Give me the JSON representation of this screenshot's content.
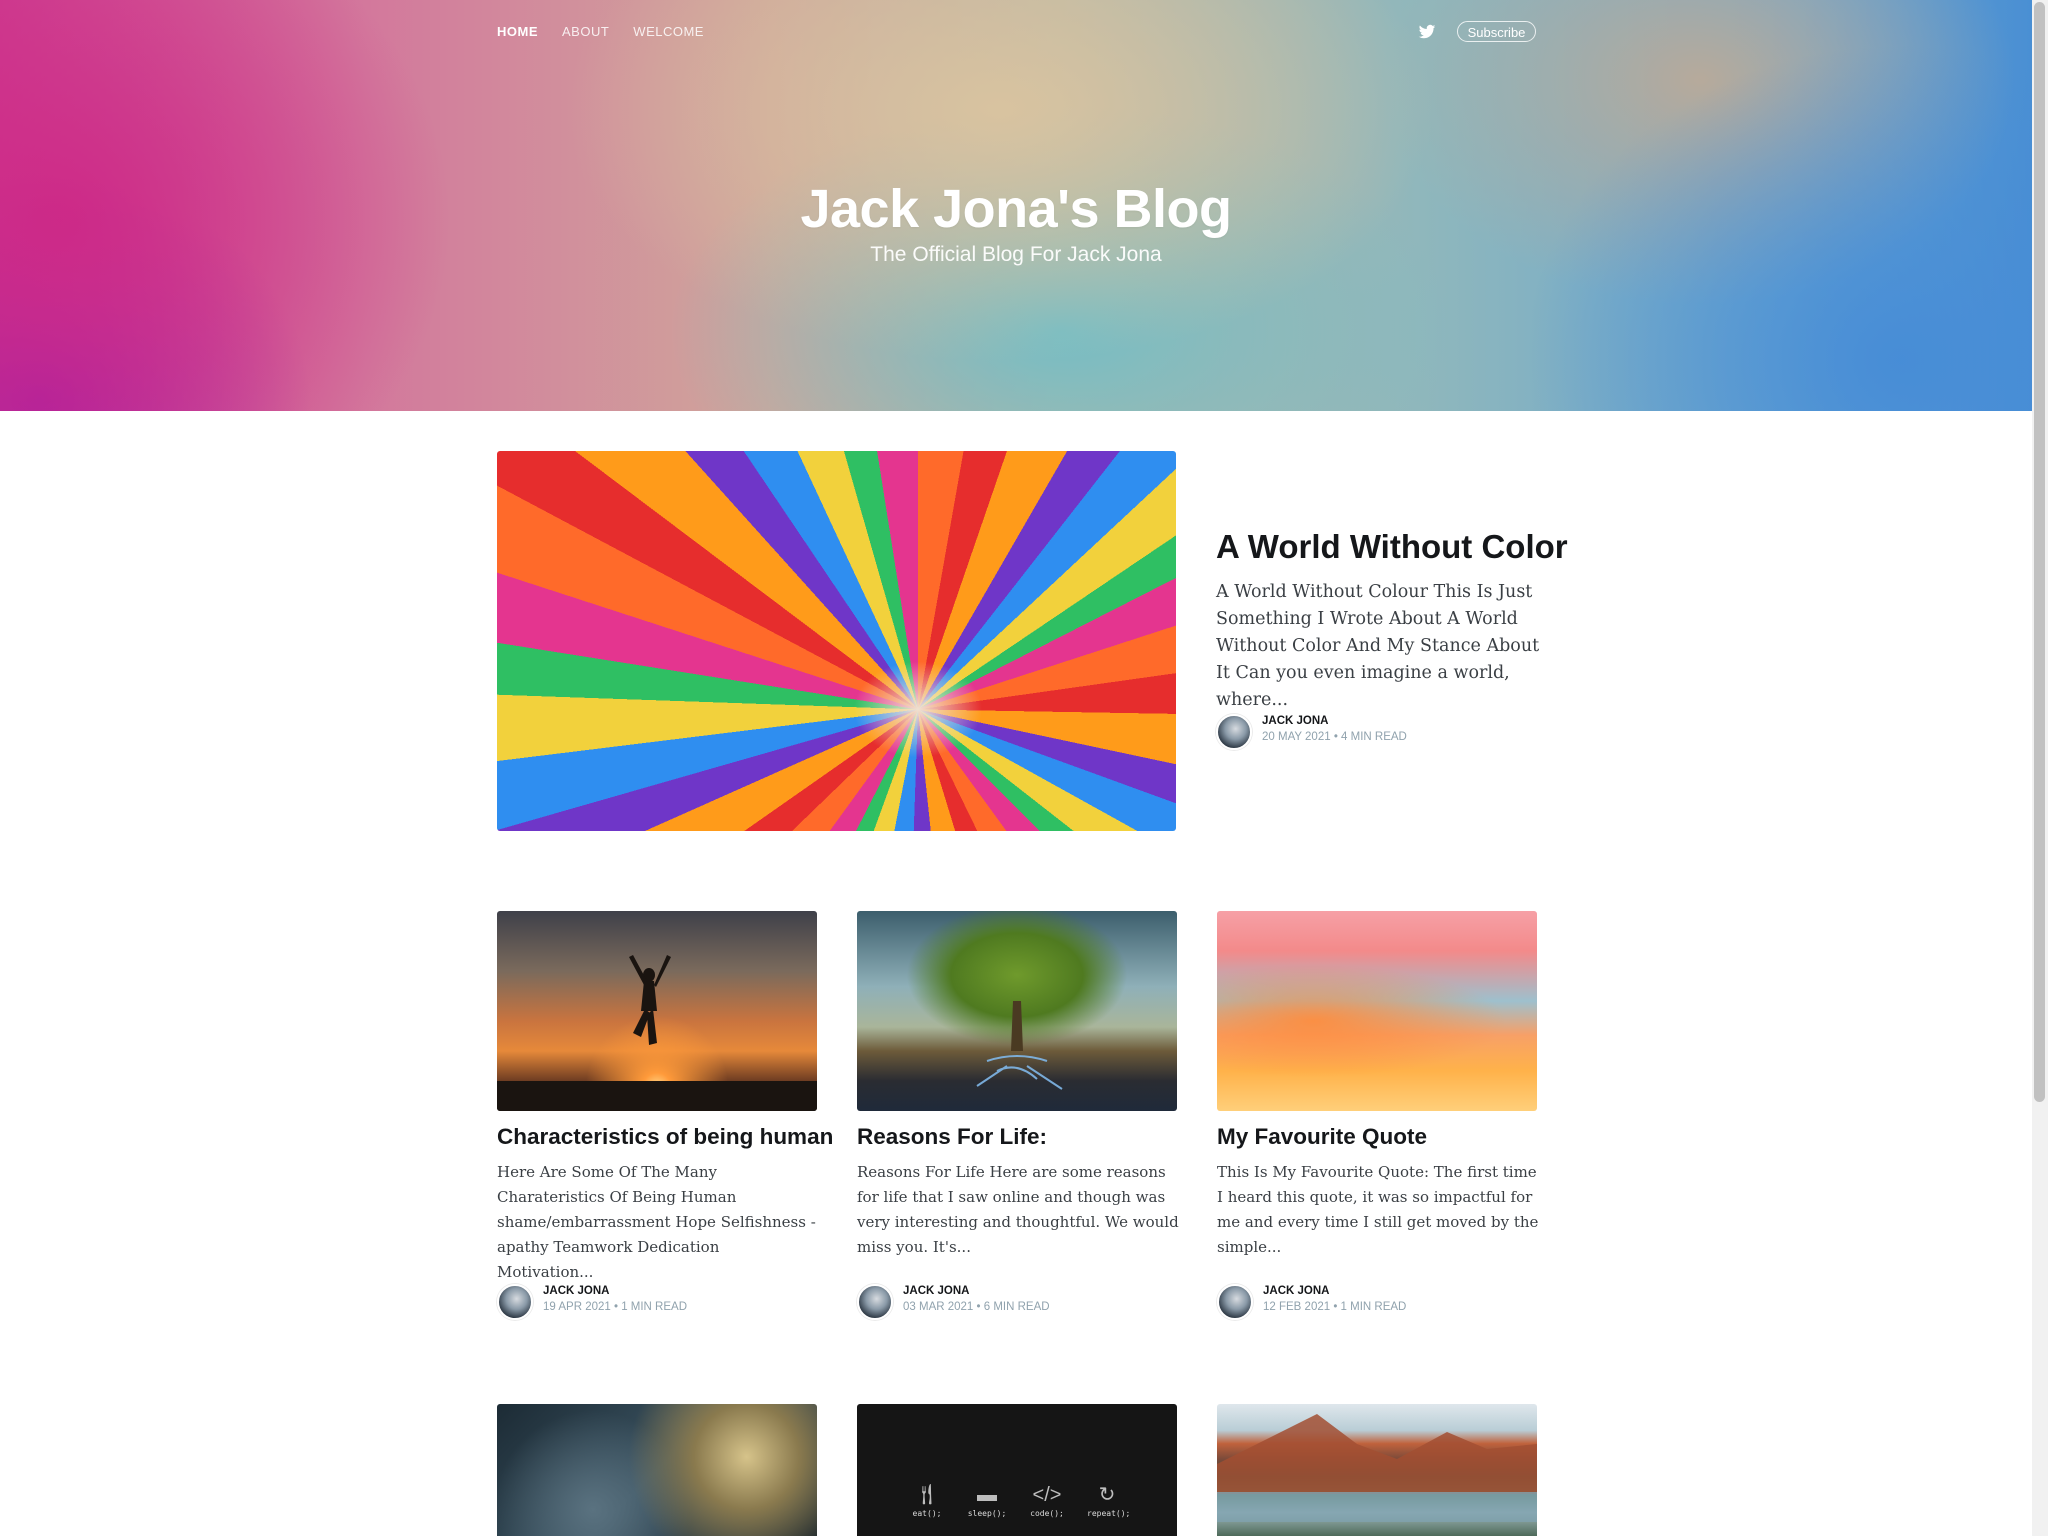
{
  "nav": {
    "items": [
      "HOME",
      "ABOUT",
      "WELCOME"
    ],
    "subscribe_label": "Subscribe",
    "twitter_icon": "twitter-icon"
  },
  "site": {
    "title": "Jack Jona's Blog",
    "description": "The Official Blog For Jack Jona"
  },
  "featured": {
    "title": "A World Without Color",
    "excerpt": "A World Without Colour This Is Just Something I Wrote About A World Without Color And My Stance About It Can you even imagine a world, where...",
    "author": "JACK JONA",
    "meta": "20 MAY 2021 • 4 MIN READ"
  },
  "posts": [
    {
      "title": "Characteristics of being human",
      "excerpt": "Here Are Some Of The Many Charateristics Of Being Human shame/embarrassment Hope Selfishness -apathy Teamwork Dedication Motivation...",
      "author": "JACK JONA",
      "meta": "19 APR 2021 • 1 MIN READ"
    },
    {
      "title": "Reasons For Life:",
      "excerpt": "Reasons For Life Here are some reasons for life that I saw online and though was very interesting and thoughtful. We would miss you. It's...",
      "author": "JACK JONA",
      "meta": "03 MAR 2021 • 6 MIN READ"
    },
    {
      "title": "My Favourite Quote",
      "excerpt": "This Is My Favourite Quote: The first time I heard this quote, it was so impactful for me and every time I still get moved by the simple...",
      "author": "JACK JONA",
      "meta": "12 FEB 2021 • 1 MIN READ"
    }
  ],
  "code_image": {
    "labels": [
      "eat();",
      "sleep();",
      "code();",
      "repeat();"
    ]
  }
}
